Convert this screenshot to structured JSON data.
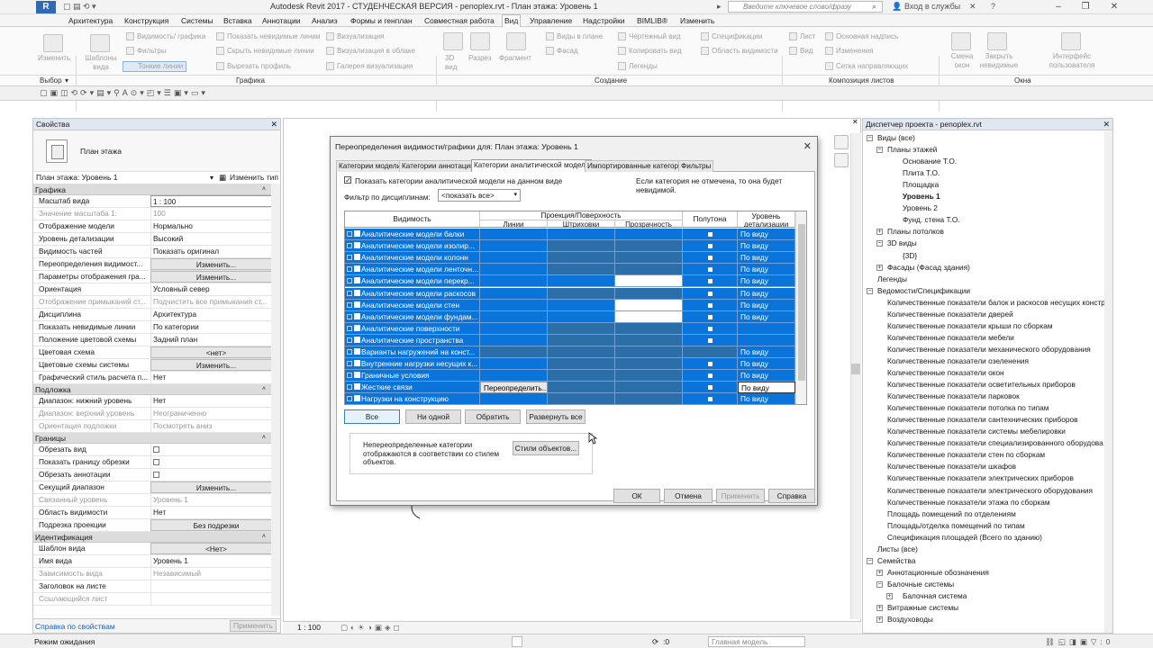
{
  "titlebar": {
    "title": "Autodesk Revit 2017 -  СТУДЕНЧЕСКАЯ ВЕРСИЯ  -   penoplex.rvt  -  План этажа: Уровень 1",
    "search_placeholder": "Введите ключевое слово/фразу",
    "signin": "Вход в службы",
    "app_letter": "R"
  },
  "ribbon_tabs": [
    "Архитектура",
    "Конструкция",
    "Системы",
    "Вставка",
    "Аннотации",
    "Анализ",
    "Формы и генплан",
    "Совместная работа",
    "Вид",
    "Управление",
    "Надстройки",
    "BIMLIB®",
    "Изменить"
  ],
  "active_tab": "Вид",
  "ribbon": {
    "modify": "Изменить",
    "templates": "Шаблоны вида",
    "visgraph": "Видимость/ графика",
    "filters": "Фильтры",
    "thin_lines": "Тонкие линии",
    "show_hidden": "Показать невидимые линии",
    "remove_hidden": "Скрыть невидимые линии",
    "cut_profile": "Вырезать профиль",
    "render": "Визуализация",
    "render_cloud": "Визуализация в облаке",
    "render_gallery": "Галерея  визуализации",
    "view3d": "3D вид",
    "section": "Разрез",
    "fragment": "Фрагмент",
    "plan_views": "Виды в плане",
    "elevation": "Фасад",
    "drafting": "Чертежный вид",
    "duplicate": "Копировать вид",
    "legends": "Легенды",
    "schedules": "Спецификации",
    "scope_box": "Область видимости",
    "sheet": "Лист",
    "view": "Вид",
    "title_block": "Основная надпись",
    "revisions": "Изменения",
    "guide_grid": "Сетка направляющих",
    "switch_windows": "Смена окон",
    "close_hidden": "Закрыть невидимые",
    "user_interface": "Интерфейс пользователя",
    "panels": {
      "select": "Выбор",
      "graphics": "Графика",
      "create": "Создание",
      "sheet_composition": "Композиция листов",
      "windows": "Окна"
    }
  },
  "properties": {
    "header": "Свойства",
    "type_name": "План этажа",
    "instance": "План этажа: Уровень 1",
    "edit_type": "Изменить тип",
    "footer_link": "Справка по свойствам",
    "apply": "Применить",
    "groups": [
      {
        "name": "Графика",
        "rows": [
          {
            "n": "Масштаб вида",
            "v": "1 : 100",
            "kind": "boxed"
          },
          {
            "n": "Значение масштаба    1:",
            "v": "100",
            "kind": "grey"
          },
          {
            "n": "Отображение модели",
            "v": "Нормально"
          },
          {
            "n": "Уровень детализации",
            "v": "Высокий"
          },
          {
            "n": "Видимость частей",
            "v": "Показать оригинал"
          },
          {
            "n": "Переопределения видимост...",
            "v": "Изменить...",
            "kind": "btn"
          },
          {
            "n": "Параметры отображения гра...",
            "v": "Изменить...",
            "kind": "btn"
          },
          {
            "n": "Ориентация",
            "v": "Условный север"
          },
          {
            "n": "Отображение примыканий ст...",
            "v": "Подчистить все примыкания ст...",
            "kind": "grey"
          },
          {
            "n": "Дисциплина",
            "v": "Архитектура"
          },
          {
            "n": "Показать невидимые линии",
            "v": "По категории"
          },
          {
            "n": "Положение цветовой схемы",
            "v": "Задний план"
          },
          {
            "n": "Цветовая схема",
            "v": "<нет>",
            "kind": "btn"
          },
          {
            "n": "Цветовые схемы системы",
            "v": "Изменить...",
            "kind": "btn"
          },
          {
            "n": "Графический стиль расчета п...",
            "v": "Нет"
          }
        ]
      },
      {
        "name": "Подложка",
        "rows": [
          {
            "n": "Диапазон: нижний уровень",
            "v": "Нет"
          },
          {
            "n": "Диапазон: верхний уровень",
            "v": "Неограниченно",
            "kind": "grey"
          },
          {
            "n": "Ориентация подложки",
            "v": "Посмотреть вниз",
            "kind": "grey"
          }
        ]
      },
      {
        "name": "Границы",
        "rows": [
          {
            "n": "Обрезать вид",
            "v": "",
            "kind": "chk"
          },
          {
            "n": "Показать границу обрезки",
            "v": "",
            "kind": "chk"
          },
          {
            "n": "Обрезать аннотации",
            "v": "",
            "kind": "chk"
          },
          {
            "n": "Секущий диапазон",
            "v": "Изменить...",
            "kind": "btn"
          },
          {
            "n": "Связанный уровень",
            "v": "Уровень 1",
            "kind": "grey"
          },
          {
            "n": "Область видимости",
            "v": "Нет"
          },
          {
            "n": "Подрезка проекции",
            "v": "Без подрезки",
            "kind": "btn"
          }
        ]
      },
      {
        "name": "Идентификация",
        "rows": [
          {
            "n": "Шаблон вида",
            "v": "<Нет>",
            "kind": "btn"
          },
          {
            "n": "Имя вида",
            "v": "Уровень 1"
          },
          {
            "n": "Зависимость вида",
            "v": "Независимый",
            "kind": "grey"
          },
          {
            "n": "Заголовок на листе",
            "v": ""
          },
          {
            "n": "Ссылающийся лист",
            "v": "",
            "kind": "grey"
          }
        ]
      }
    ]
  },
  "canvas": {
    "scale": "1 : 100"
  },
  "browser": {
    "header": "Диспетчер проекта - penoplex.rvt",
    "items": [
      {
        "t": "Виды (все)",
        "lvl": 0,
        "exp": "−"
      },
      {
        "t": "Планы этажей",
        "lvl": 1,
        "exp": "−"
      },
      {
        "t": "Основание Т.О.",
        "lvl": 2
      },
      {
        "t": "Плита Т.О.",
        "lvl": 2
      },
      {
        "t": "Площадка",
        "lvl": 2
      },
      {
        "t": "Уровень 1",
        "lvl": 2,
        "bold": true
      },
      {
        "t": "Уровень 2",
        "lvl": 2
      },
      {
        "t": "Фунд. стена Т.О.",
        "lvl": 2
      },
      {
        "t": "Планы потолков",
        "lvl": 1,
        "exp": "+"
      },
      {
        "t": "3D виды",
        "lvl": 1,
        "exp": "−"
      },
      {
        "t": "{3D}",
        "lvl": 2
      },
      {
        "t": "Фасады (Фасад здания)",
        "lvl": 1,
        "exp": "+"
      },
      {
        "t": "Легенды",
        "lvl": 0
      },
      {
        "t": "Ведомости/Спецификации",
        "lvl": 0,
        "exp": "−"
      },
      {
        "t": "Количественные показатели балок и раскосов несущих констр",
        "lvl": 1
      },
      {
        "t": "Количественные показатели дверей",
        "lvl": 1
      },
      {
        "t": "Количественные показатели крыши по сборкам",
        "lvl": 1
      },
      {
        "t": "Количественные показатели мебели",
        "lvl": 1
      },
      {
        "t": "Количественные показатели механического оборудования",
        "lvl": 1
      },
      {
        "t": "Количественные показатели озеленения",
        "lvl": 1
      },
      {
        "t": "Количественные показатели окон",
        "lvl": 1
      },
      {
        "t": "Количественные показатели осветительных приборов",
        "lvl": 1
      },
      {
        "t": "Количественные показатели парковок",
        "lvl": 1
      },
      {
        "t": "Количественные показатели потолка по типам",
        "lvl": 1
      },
      {
        "t": "Количественные показатели сантехнических приборов",
        "lvl": 1
      },
      {
        "t": "Количественные показатели системы мебелировки",
        "lvl": 1
      },
      {
        "t": "Количественные показатели специализированного оборудова",
        "lvl": 1
      },
      {
        "t": "Количественные показатели стен по сборкам",
        "lvl": 1
      },
      {
        "t": "Количественные показатели шкафов",
        "lvl": 1
      },
      {
        "t": "Количественные показатели электрических приборов",
        "lvl": 1
      },
      {
        "t": "Количественные показатели электрического оборудования",
        "lvl": 1
      },
      {
        "t": "Количественные показатели этажа по сборкам",
        "lvl": 1
      },
      {
        "t": "Площадь помещений по отделениям",
        "lvl": 1
      },
      {
        "t": "Площадь/отделка помещений по типам",
        "lvl": 1
      },
      {
        "t": "Спецификация площадей (Всего по зданию)",
        "lvl": 1
      },
      {
        "t": "Листы (все)",
        "lvl": 0
      },
      {
        "t": "Семейства",
        "lvl": 0,
        "exp": "−"
      },
      {
        "t": "Аннотационные обозначения",
        "lvl": 1,
        "exp": "+"
      },
      {
        "t": "Балочные системы",
        "lvl": 1,
        "exp": "−"
      },
      {
        "t": "Балочная система",
        "lvl": 2,
        "exp": "+"
      },
      {
        "t": "Витражные системы",
        "lvl": 1,
        "exp": "+"
      },
      {
        "t": "Воздуховоды",
        "lvl": 1,
        "exp": "+"
      }
    ]
  },
  "status": {
    "text": "Режим ожидания",
    "model": "Главная модель",
    "zero": ":0"
  },
  "dialog": {
    "title": "Переопределения видимости/графики для: План этажа: Уровень 1",
    "tabs": [
      "Категории модели",
      "Категории аннотаций",
      "Категории аналитической модели",
      "Импортированные категории",
      "Фильтры"
    ],
    "active_tab": 2,
    "show_checkbox": "Показать категории аналитической модели на данном виде",
    "hint": "Если категория не отмечена, то она будет невидимой.",
    "filter_label": "Фильтр по дисциплинам:",
    "filter_value": "<показать все>",
    "columns": {
      "visibility": "Видимость",
      "projection": "Проекция/Поверхность",
      "lines": "Линии",
      "hatch": "Штриховки",
      "transparency": "Прозрачность",
      "halftone": "Полутона",
      "detail": "Уровень детализации"
    },
    "rows": [
      {
        "name": "Аналитические модели балки",
        "hal": true,
        "lev": "По виду"
      },
      {
        "name": "Аналитические модели изолир...",
        "hal": true,
        "lev": "По виду",
        "dim_hat": true,
        "dim_tra": true
      },
      {
        "name": "Аналитические модели колонн",
        "hal": true,
        "lev": "По виду",
        "dim_hat": true,
        "dim_tra": true
      },
      {
        "name": "Аналитические модели ленточн...",
        "hal": true,
        "lev": "По виду",
        "dim_hat": true,
        "dim_tra": true
      },
      {
        "name": "Аналитические модели перекр...",
        "hal": true,
        "lev": "По виду",
        "white_tra": true
      },
      {
        "name": "Аналитические модели раскосов",
        "hal": true,
        "lev": "По виду",
        "dim_hat": true,
        "dim_tra": true
      },
      {
        "name": "Аналитические модели стен",
        "hal": true,
        "lev": "По виду",
        "white_tra": true
      },
      {
        "name": "Аналитические модели фундам...",
        "hal": true,
        "lev": "По виду",
        "white_tra": true
      },
      {
        "name": "Аналитические поверхности",
        "hal": true,
        "lev": "",
        "dim_hat": true,
        "dim_tra": true
      },
      {
        "name": "Аналитические пространства",
        "hal": true,
        "lev": "",
        "dim_hat": true,
        "dim_tra": true
      },
      {
        "name": "Варианты нагружений на конст...",
        "hal": false,
        "lev": "По виду",
        "dim_lin": true,
        "dim_hat": true,
        "dim_tra": true,
        "dim_hal": true
      },
      {
        "name": "Внутренние нагрузки несущих к...",
        "hal": true,
        "lev": "По виду",
        "dim_hat": true,
        "dim_tra": true
      },
      {
        "name": "Граничные условия",
        "hal": true,
        "lev": "По виду",
        "dim_hat": true,
        "dim_tra": true
      },
      {
        "name": "Жесткие связи",
        "hal": true,
        "lev": "По виду",
        "sel": true,
        "btn_lin": "Переопределить...",
        "dim_hat": true,
        "dim_tra": true
      },
      {
        "name": "Нагрузки на конструкцию",
        "hal": true,
        "lev": "По виду",
        "dim_hat": true,
        "dim_tra": true
      }
    ],
    "buttons": {
      "all": "Все",
      "none": "Ни одной",
      "invert": "Обратить",
      "expand": "Развернуть все",
      "obj_styles": "Стили объектов...",
      "ok": "ОК",
      "cancel": "Отмена",
      "apply": "Применить",
      "help": "Справка"
    },
    "note": "Непереопределенные категории отображаются в соответствии со стилем объектов."
  }
}
